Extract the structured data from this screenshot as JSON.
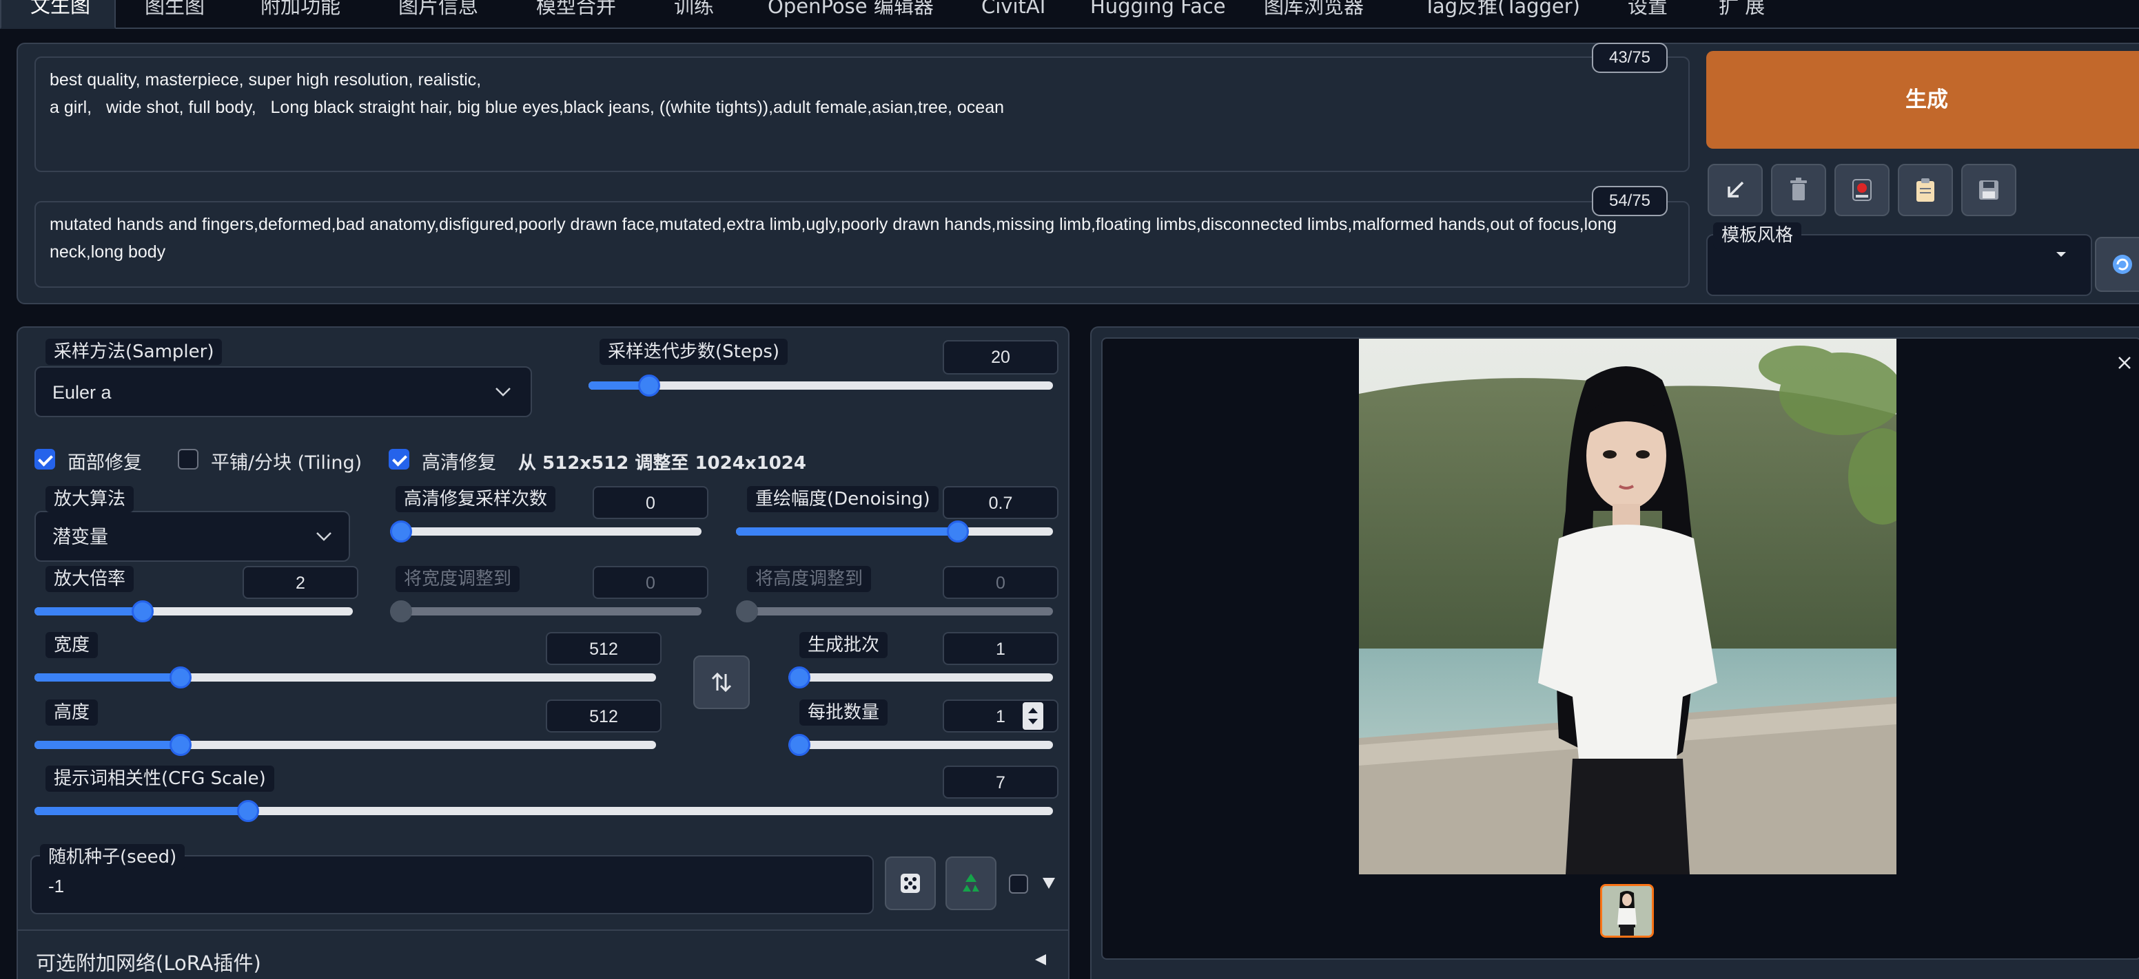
{
  "tabs": [
    "文生图",
    "图生图",
    "附加功能",
    "图片信息",
    "模型合并",
    "训练",
    "OpenPose 编辑器",
    "CivitAI",
    "Hugging Face",
    "图库浏览器",
    "Tag反推(Tagger)",
    "设置",
    "扩 展"
  ],
  "prompt": {
    "positive": "best quality, masterpiece, super high resolution, realistic,\na girl,   wide shot, full body,   Long black straight hair, big blue eyes,black jeans, ((white tights)),adult female,asian,tree, ocean",
    "positive_count": "43/75",
    "negative": "mutated hands and fingers,deformed,bad anatomy,disfigured,poorly drawn face,mutated,extra limb,ugly,poorly drawn hands,missing limb,floating limbs,disconnected limbs,malformed hands,out of focus,long neck,long body",
    "negative_count": "54/75"
  },
  "generate_label": "生成",
  "style_label": "模板风格",
  "tool_icons": [
    "arrow-in-icon",
    "trash-icon",
    "camera-icon",
    "clipboard-icon",
    "save-icon"
  ],
  "sampler": {
    "label": "采样方法(Sampler)",
    "value": "Euler a"
  },
  "steps": {
    "label": "采样迭代步数(Steps)",
    "value": "20",
    "fraction": 0.13
  },
  "checks": {
    "face_fix": {
      "label": "面部修复",
      "checked": true
    },
    "tiling": {
      "label": "平铺/分块 (Tiling)",
      "checked": false
    },
    "hires": {
      "label": "高清修复",
      "checked": true
    },
    "hires_info": "从 512x512 调整至 1024x1024"
  },
  "upscaler": {
    "label": "放大算法",
    "value": "潜变量"
  },
  "hires_steps": {
    "label": "高清修复采样次数",
    "value": "0",
    "fraction": 0.0
  },
  "denoising": {
    "label": "重绘幅度(Denoising)",
    "value": "0.7",
    "fraction": 0.7
  },
  "upscale_by": {
    "label": "放大倍率",
    "value": "2",
    "fraction": 0.34
  },
  "resize_w": {
    "label": "将宽度调整到",
    "value": "0",
    "fraction": 0.0
  },
  "resize_h": {
    "label": "将高度调整到",
    "value": "0",
    "fraction": 0.0
  },
  "width": {
    "label": "宽度",
    "value": "512",
    "fraction": 0.235
  },
  "height": {
    "label": "高度",
    "value": "512",
    "fraction": 0.235
  },
  "batch_count": {
    "label": "生成批次",
    "value": "1",
    "fraction": 0.0
  },
  "batch_size": {
    "label": "每批数量",
    "value": "1",
    "fraction": 0.0
  },
  "cfg": {
    "label": "提示词相关性(CFG Scale)",
    "value": "7",
    "fraction": 0.21
  },
  "seed": {
    "label": "随机种子(seed)",
    "value": "-1"
  },
  "lora_label": "可选附加网络(LoRA插件)",
  "colors": {
    "accent": "#3b82f6",
    "generate": "#c2682b",
    "panel": "#1f2937",
    "bg": "#0b0f19"
  }
}
